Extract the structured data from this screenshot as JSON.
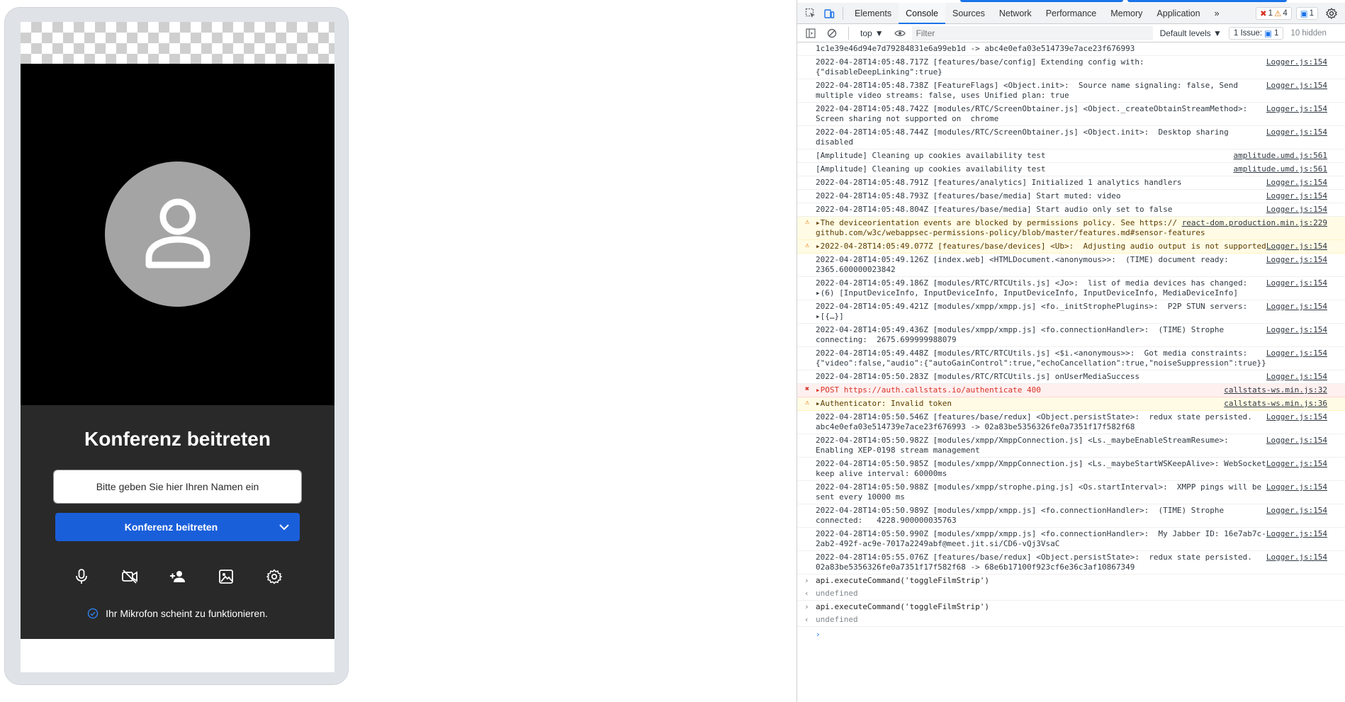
{
  "prejoin": {
    "title": "Konferenz beitreten",
    "name_placeholder": "Bitte geben Sie hier Ihren Namen ein",
    "join_label": "Konferenz beitreten",
    "mic_status": "Ihr Mikrofon scheint zu funktionieren.",
    "tools": [
      "microphone-icon",
      "camera-off-icon",
      "invite-user-icon",
      "virtual-background-icon",
      "settings-icon"
    ]
  },
  "devtools": {
    "tabs": [
      "Elements",
      "Console",
      "Sources",
      "Network",
      "Performance",
      "Memory",
      "Application"
    ],
    "active_tab": "Console",
    "more_tabs": "»",
    "error_count": "1",
    "warning_count": "4",
    "message_count": "1",
    "context": "top",
    "filter_placeholder": "Filter",
    "levels": "Default levels",
    "issues_label": "1 Issue:",
    "issues_count": "1",
    "hidden_label": "10 hidden"
  },
  "console": [
    {
      "type": "log",
      "text": "1c1e39e46d94e7d79284831e6a99eb1d -> abc4e0efa03e514739e7ace23f676993",
      "src": ""
    },
    {
      "type": "log",
      "text": "2022-04-28T14:05:48.717Z [features/base/config] Extending config with: {\"disableDeepLinking\":true}",
      "src": "Logger.js:154"
    },
    {
      "type": "log",
      "text": "2022-04-28T14:05:48.738Z [FeatureFlags] <Object.init>:  Source name signaling: false, Send multiple video streams: false, uses Unified plan: true",
      "src": "Logger.js:154"
    },
    {
      "type": "log",
      "text": "2022-04-28T14:05:48.742Z [modules/RTC/ScreenObtainer.js] <Object._createObtainStreamMethod>: Screen sharing not supported on  chrome",
      "src": "Logger.js:154"
    },
    {
      "type": "log",
      "text": "2022-04-28T14:05:48.744Z [modules/RTC/ScreenObtainer.js] <Object.init>:  Desktop sharing disabled",
      "src": "Logger.js:154"
    },
    {
      "type": "log",
      "text": "[Amplitude] Cleaning up cookies availability test",
      "src": "amplitude.umd.js:561"
    },
    {
      "type": "log",
      "text": "[Amplitude] Cleaning up cookies availability test",
      "src": "amplitude.umd.js:561"
    },
    {
      "type": "log",
      "text": "2022-04-28T14:05:48.791Z [features/analytics] Initialized 1 analytics handlers",
      "src": "Logger.js:154"
    },
    {
      "type": "log",
      "text": "2022-04-28T14:05:48.793Z [features/base/media] Start muted: video",
      "src": "Logger.js:154"
    },
    {
      "type": "log",
      "text": "2022-04-28T14:05:48.804Z [features/base/media] Start audio only set to false",
      "src": "Logger.js:154"
    },
    {
      "type": "warn",
      "text": "▸The deviceorientation events are blocked by permissions policy. See https:// github.com/w3c/webappsec-permissions-policy/blob/master/features.md#sensor-features",
      "src": "react-dom.production.min.js:229"
    },
    {
      "type": "warn",
      "text": "▸2022-04-28T14:05:49.077Z [features/base/devices] <Ub>:  Adjusting audio output is not supported",
      "src": "Logger.js:154"
    },
    {
      "type": "log",
      "text": "2022-04-28T14:05:49.126Z [index.web] <HTMLDocument.<anonymous>>:  (TIME) document ready: 2365.600000023842",
      "src": "Logger.js:154"
    },
    {
      "type": "log",
      "text": "2022-04-28T14:05:49.186Z [modules/RTC/RTCUtils.js] <Jo>:  list of media devices has changed: ▸(6) [InputDeviceInfo, InputDeviceInfo, InputDeviceInfo, InputDeviceInfo, MediaDeviceInfo]",
      "src": "Logger.js:154"
    },
    {
      "type": "log",
      "text": "2022-04-28T14:05:49.421Z [modules/xmpp/xmpp.js] <fo._initStrophePlugins>:  P2P STUN servers: ▸[{…}]",
      "src": "Logger.js:154"
    },
    {
      "type": "log",
      "text": "2022-04-28T14:05:49.436Z [modules/xmpp/xmpp.js] <fo.connectionHandler>:  (TIME) Strophe connecting:  2675.699999988079",
      "src": "Logger.js:154"
    },
    {
      "type": "log",
      "text": "2022-04-28T14:05:49.448Z [modules/RTC/RTCUtils.js] <$i.<anonymous>>:  Got media constraints: {\"video\":false,\"audio\":{\"autoGainControl\":true,\"echoCancellation\":true,\"noiseSuppression\":true}}",
      "src": "Logger.js:154"
    },
    {
      "type": "log",
      "text": "2022-04-28T14:05:50.283Z [modules/RTC/RTCUtils.js] onUserMediaSuccess",
      "src": "Logger.js:154"
    },
    {
      "type": "error",
      "text": "▸POST https://auth.callstats.io/authenticate 400",
      "src": "callstats-ws.min.js:32"
    },
    {
      "type": "warn",
      "text": "▸Authenticator: Invalid token",
      "src": "callstats-ws.min.js:36"
    },
    {
      "type": "log",
      "text": "2022-04-28T14:05:50.546Z [features/base/redux] <Object.persistState>:  redux state persisted. abc4e0efa03e514739e7ace23f676993 -> 02a83be5356326fe0a7351f17f582f68",
      "src": "Logger.js:154"
    },
    {
      "type": "log",
      "text": "2022-04-28T14:05:50.982Z [modules/xmpp/XmppConnection.js] <Ls._maybeEnableStreamResume>: Enabling XEP-0198 stream management",
      "src": "Logger.js:154"
    },
    {
      "type": "log",
      "text": "2022-04-28T14:05:50.985Z [modules/xmpp/XmppConnection.js] <Ls._maybeStartWSKeepAlive>: WebSocket keep alive interval: 60000ms",
      "src": "Logger.js:154"
    },
    {
      "type": "log",
      "text": "2022-04-28T14:05:50.988Z [modules/xmpp/strophe.ping.js] <Os.startInterval>:  XMPP pings will be sent every 10000 ms",
      "src": "Logger.js:154"
    },
    {
      "type": "log",
      "text": "2022-04-28T14:05:50.989Z [modules/xmpp/xmpp.js] <fo.connectionHandler>:  (TIME) Strophe connected:   4228.900000035763",
      "src": "Logger.js:154"
    },
    {
      "type": "log",
      "text": "2022-04-28T14:05:50.990Z [modules/xmpp/xmpp.js] <fo.connectionHandler>:  My Jabber ID: 16e7ab7c-2ab2-492f-ac9e-7017a2249abf@meet.jit.si/CD6-vQj3VsaC",
      "src": "Logger.js:154"
    },
    {
      "type": "log",
      "text": "2022-04-28T14:05:55.076Z [features/base/redux] <Object.persistState>:  redux state persisted. 02a83be5356326fe0a7351f17f582f68 -> 68e6b17100f923cf6e36c3af10867349",
      "src": "Logger.js:154"
    },
    {
      "type": "input",
      "text": "api.executeCommand('toggleFilmStrip')",
      "src": ""
    },
    {
      "type": "result",
      "text": "undefined",
      "src": ""
    },
    {
      "type": "input",
      "text": "api.executeCommand('toggleFilmStrip')",
      "src": ""
    },
    {
      "type": "result",
      "text": "undefined",
      "src": ""
    }
  ],
  "colors": {
    "accent": "#1a73e8",
    "join_button": "#1a5fda",
    "prejoin_bg": "#292929",
    "warning_bg": "#fffbe5",
    "error_bg": "#fff0f0"
  }
}
